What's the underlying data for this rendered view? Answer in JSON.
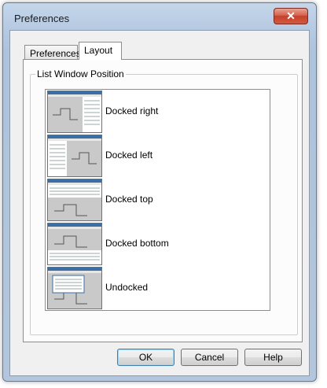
{
  "window": {
    "title": "Preferences",
    "close_glyph": "✕"
  },
  "tabs": [
    {
      "label": "Preferences",
      "active": false
    },
    {
      "label": "Layout",
      "active": true
    }
  ],
  "group": {
    "label": "List Window Position"
  },
  "layout_options": [
    {
      "label": "Docked right",
      "icon": "docked-right-thumbnail"
    },
    {
      "label": "Docked left",
      "icon": "docked-left-thumbnail"
    },
    {
      "label": "Docked top",
      "icon": "docked-top-thumbnail"
    },
    {
      "label": "Docked bottom",
      "icon": "docked-bottom-thumbnail"
    },
    {
      "label": "Undocked",
      "icon": "undocked-thumbnail"
    }
  ],
  "buttons": {
    "ok": "OK",
    "cancel": "Cancel",
    "help": "Help"
  },
  "colors": {
    "title_gradient": "#b7cbe3",
    "close_button": "#c2412b",
    "panel": "#f0f0f0"
  }
}
